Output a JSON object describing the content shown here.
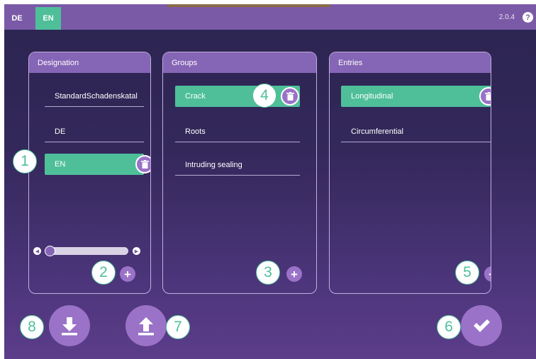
{
  "header": {
    "languages": [
      {
        "label": "DE",
        "active": false
      },
      {
        "label": "EN",
        "active": true
      }
    ],
    "version": "2.0.4",
    "help_glyph": "?"
  },
  "panels": {
    "designation": {
      "title": "Designation",
      "items": [
        {
          "label": "StandardSchadenskatal",
          "selected": false
        },
        {
          "label": "DE",
          "selected": false
        },
        {
          "label": "EN",
          "selected": true
        }
      ],
      "scrollbar_position": 0.0
    },
    "groups": {
      "title": "Groups",
      "items": [
        {
          "label": "Crack",
          "selected": true
        },
        {
          "label": "Roots",
          "selected": false
        },
        {
          "label": "Intruding sealing",
          "selected": false
        }
      ]
    },
    "entries": {
      "title": "Entries",
      "items": [
        {
          "label": "Longitudinal",
          "selected": true
        },
        {
          "label": "Circumferential",
          "selected": false
        }
      ]
    }
  },
  "add_glyph": "+",
  "callouts": [
    "1",
    "2",
    "3",
    "4",
    "5",
    "6",
    "7",
    "8"
  ],
  "icons": {
    "delete": "trash-icon",
    "add": "plus-icon",
    "import": "download-icon",
    "export": "upload-icon",
    "confirm": "checkmark-icon",
    "help": "question-icon"
  },
  "colors": {
    "accent_green": "#4fbf9a",
    "purple_button": "#9a72c8",
    "panel_header": "#8565b5",
    "topbar": "#7a5aa6"
  }
}
